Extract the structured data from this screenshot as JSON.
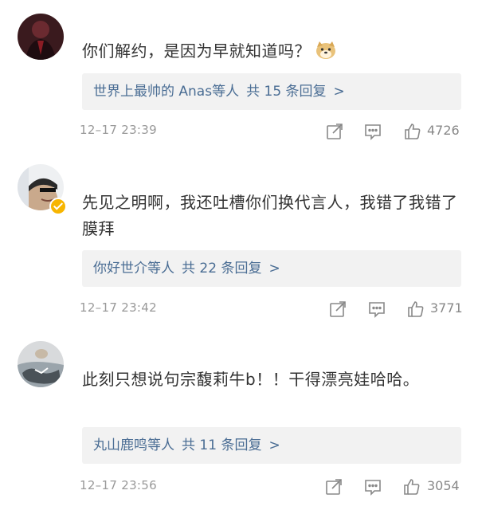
{
  "comments": [
    {
      "text": "你们解约，是因为早就知道吗？",
      "emoji": "doge-emoji",
      "replies": {
        "users": "世界上最帅的 Anas",
        "suffix": "等人",
        "count": "共 15 条回复",
        "arrow": ">"
      },
      "timestamp": "12–17 23:39",
      "likes": "4726"
    },
    {
      "text": "先见之明啊，我还吐槽你们换代言人，我错了我错了膜拜",
      "verified": true,
      "replies": {
        "users": "你好世介",
        "suffix": "等人",
        "count": "共 22 条回复",
        "arrow": ">"
      },
      "timestamp": "12–17 23:42",
      "likes": "3771"
    },
    {
      "text": "此刻只想说句宗馥莉牛b！！干得漂亮娃哈哈。",
      "replies": {
        "users": "丸山鹿鸣",
        "suffix": "等人",
        "count": "共 11 条回复",
        "arrow": ">"
      },
      "timestamp": "12–17 23:56",
      "likes": "3054"
    }
  ],
  "icons": {
    "share": "share-icon",
    "comment": "comment-icon",
    "like": "thumbs-up-icon"
  },
  "colors": {
    "link": "#4a6d94",
    "muted": "#999999",
    "reply_bg": "#f2f2f2",
    "verified_badge": "#f7b500"
  }
}
